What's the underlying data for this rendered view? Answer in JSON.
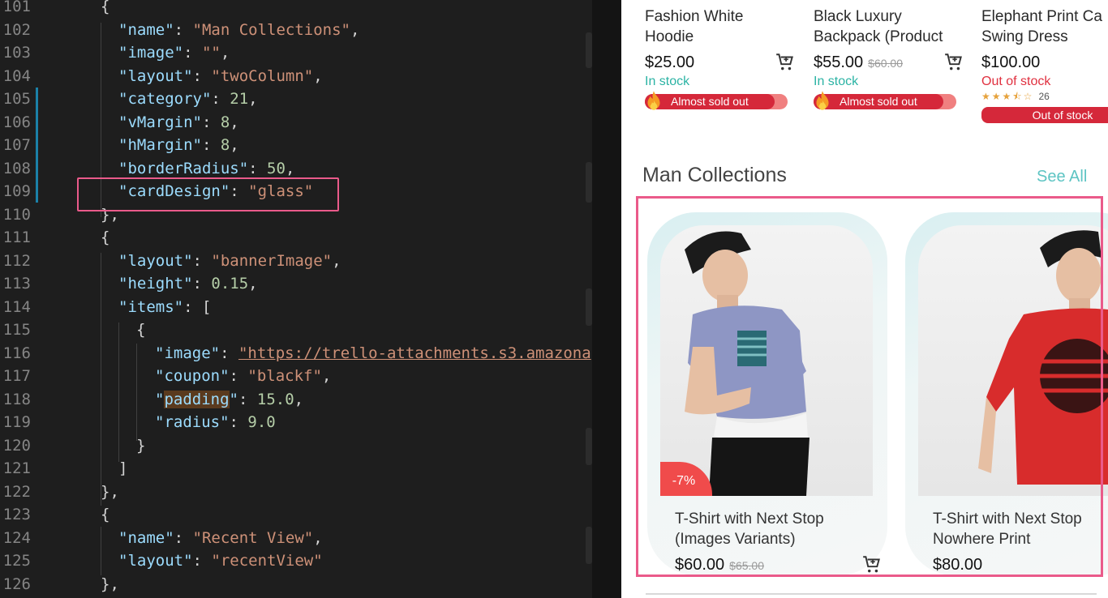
{
  "editor": {
    "lines": [
      {
        "n": "101",
        "indent": 124,
        "tokens": [
          {
            "t": "{",
            "c": "p"
          }
        ]
      },
      {
        "n": "102",
        "indent": 146,
        "tokens": [
          {
            "t": "\"name\"",
            "c": "k"
          },
          {
            "t": ": ",
            "c": "p"
          },
          {
            "t": "\"Man Collections\"",
            "c": "s"
          },
          {
            "t": ",",
            "c": "p"
          }
        ]
      },
      {
        "n": "103",
        "indent": 146,
        "tokens": [
          {
            "t": "\"image\"",
            "c": "k"
          },
          {
            "t": ": ",
            "c": "p"
          },
          {
            "t": "\"\"",
            "c": "s"
          },
          {
            "t": ",",
            "c": "p"
          }
        ]
      },
      {
        "n": "104",
        "indent": 146,
        "tokens": [
          {
            "t": "\"layout\"",
            "c": "k"
          },
          {
            "t": ": ",
            "c": "p"
          },
          {
            "t": "\"twoColumn\"",
            "c": "s"
          },
          {
            "t": ",",
            "c": "p"
          }
        ]
      },
      {
        "n": "105",
        "indent": 146,
        "tokens": [
          {
            "t": "\"category\"",
            "c": "k"
          },
          {
            "t": ": ",
            "c": "p"
          },
          {
            "t": "21",
            "c": "n"
          },
          {
            "t": ",",
            "c": "p"
          }
        ]
      },
      {
        "n": "106",
        "indent": 146,
        "tokens": [
          {
            "t": "\"vMargin\"",
            "c": "k"
          },
          {
            "t": ": ",
            "c": "p"
          },
          {
            "t": "8",
            "c": "n"
          },
          {
            "t": ",",
            "c": "p"
          }
        ]
      },
      {
        "n": "107",
        "indent": 146,
        "tokens": [
          {
            "t": "\"hMargin\"",
            "c": "k"
          },
          {
            "t": ": ",
            "c": "p"
          },
          {
            "t": "8",
            "c": "n"
          },
          {
            "t": ",",
            "c": "p"
          }
        ]
      },
      {
        "n": "108",
        "indent": 146,
        "tokens": [
          {
            "t": "\"borderRadius\"",
            "c": "k"
          },
          {
            "t": ": ",
            "c": "p"
          },
          {
            "t": "50",
            "c": "n"
          },
          {
            "t": ",",
            "c": "p"
          }
        ]
      },
      {
        "n": "109",
        "indent": 146,
        "tokens": [
          {
            "t": "\"cardDesign\"",
            "c": "k"
          },
          {
            "t": ": ",
            "c": "p"
          },
          {
            "t": "\"glass\"",
            "c": "s"
          }
        ]
      },
      {
        "n": "110",
        "indent": 124,
        "tokens": [
          {
            "t": "},",
            "c": "p"
          }
        ]
      },
      {
        "n": "111",
        "indent": 124,
        "tokens": [
          {
            "t": "{",
            "c": "p"
          }
        ]
      },
      {
        "n": "112",
        "indent": 146,
        "tokens": [
          {
            "t": "\"layout\"",
            "c": "k"
          },
          {
            "t": ": ",
            "c": "p"
          },
          {
            "t": "\"bannerImage\"",
            "c": "s"
          },
          {
            "t": ",",
            "c": "p"
          }
        ]
      },
      {
        "n": "113",
        "indent": 146,
        "tokens": [
          {
            "t": "\"height\"",
            "c": "k"
          },
          {
            "t": ": ",
            "c": "p"
          },
          {
            "t": "0.15",
            "c": "n"
          },
          {
            "t": ",",
            "c": "p"
          }
        ]
      },
      {
        "n": "114",
        "indent": 146,
        "tokens": [
          {
            "t": "\"items\"",
            "c": "k"
          },
          {
            "t": ": [",
            "c": "p"
          }
        ]
      },
      {
        "n": "115",
        "indent": 168,
        "tokens": [
          {
            "t": "{",
            "c": "p"
          }
        ]
      },
      {
        "n": "116",
        "indent": 191,
        "tokens": [
          {
            "t": "\"image\"",
            "c": "k"
          },
          {
            "t": ": ",
            "c": "p"
          },
          {
            "t": "\"https://trello-attachments.s3.amazona",
            "c": "u"
          }
        ]
      },
      {
        "n": "117",
        "indent": 191,
        "tokens": [
          {
            "t": "\"coupon\"",
            "c": "k"
          },
          {
            "t": ": ",
            "c": "p"
          },
          {
            "t": "\"blackf\"",
            "c": "s"
          },
          {
            "t": ",",
            "c": "p"
          }
        ]
      },
      {
        "n": "118",
        "indent": 191,
        "tokens": [
          {
            "t": "\"",
            "c": "k"
          },
          {
            "t": "padding",
            "c": "k hl"
          },
          {
            "t": "\"",
            "c": "k"
          },
          {
            "t": ": ",
            "c": "p"
          },
          {
            "t": "15.0",
            "c": "n"
          },
          {
            "t": ",",
            "c": "p"
          }
        ]
      },
      {
        "n": "119",
        "indent": 191,
        "tokens": [
          {
            "t": "\"radius\"",
            "c": "k"
          },
          {
            "t": ": ",
            "c": "p"
          },
          {
            "t": "9.0",
            "c": "n"
          }
        ]
      },
      {
        "n": "120",
        "indent": 168,
        "tokens": [
          {
            "t": "}",
            "c": "p"
          }
        ]
      },
      {
        "n": "121",
        "indent": 146,
        "tokens": [
          {
            "t": "]",
            "c": "p"
          }
        ]
      },
      {
        "n": "122",
        "indent": 124,
        "tokens": [
          {
            "t": "},",
            "c": "p"
          }
        ]
      },
      {
        "n": "123",
        "indent": 124,
        "tokens": [
          {
            "t": "{",
            "c": "p"
          }
        ]
      },
      {
        "n": "124",
        "indent": 146,
        "tokens": [
          {
            "t": "\"name\"",
            "c": "k"
          },
          {
            "t": ": ",
            "c": "p"
          },
          {
            "t": "\"Recent View\"",
            "c": "s"
          },
          {
            "t": ",",
            "c": "p"
          }
        ]
      },
      {
        "n": "125",
        "indent": 146,
        "tokens": [
          {
            "t": "\"layout\"",
            "c": "k"
          },
          {
            "t": ": ",
            "c": "p"
          },
          {
            "t": "\"recentView\"",
            "c": "s"
          }
        ]
      },
      {
        "n": "126",
        "indent": 124,
        "tokens": [
          {
            "t": "},",
            "c": "p"
          }
        ]
      }
    ],
    "colors": {
      "key": "#9cdcfe",
      "string": "#ce9178",
      "number": "#b5cea8",
      "highlight_box": "#ea5a8a"
    }
  },
  "app": {
    "top_products": [
      {
        "title_line1": "Fashion White",
        "title_line2": "Hoodie",
        "price": "$25.00",
        "old_price": "",
        "stock": "In stock",
        "stock_type": "in",
        "badge": "Almost sold out",
        "cart_icon": "add-to-cart-icon"
      },
      {
        "title_line1": "Black Luxury",
        "title_line2": "Backpack (Product",
        "price": "$55.00",
        "old_price": "$60.00",
        "stock": "In stock",
        "stock_type": "in",
        "badge": "Almost sold out",
        "cart_icon": "add-to-cart-icon"
      },
      {
        "title_line1": "Elephant Print Ca",
        "title_line2": "Swing Dress",
        "price": "$100.00",
        "old_price": "",
        "stock": "Out of stock",
        "stock_type": "out",
        "rating_count": "26",
        "rating": 3.5,
        "badge": "Out of stock"
      }
    ],
    "section": {
      "title": "Man Collections",
      "see_all": "See All"
    },
    "collection_cards": [
      {
        "title_line1": "T-Shirt with Next Stop",
        "title_line2": "(Images Variants)",
        "price": "$60.00",
        "old_price": "$65.00",
        "discount": "-7%"
      },
      {
        "title_line1": "T-Shirt with Next Stop",
        "title_line2": "Nowhere Print",
        "price": "$80.00",
        "old_price": ""
      }
    ],
    "colors": {
      "accent_teal": "#5dc4c3",
      "sale_red": "#d5283a",
      "frame_pink": "#ea5a8a",
      "in_stock": "#2bb3a4",
      "out_of_stock": "#e0303f"
    }
  }
}
